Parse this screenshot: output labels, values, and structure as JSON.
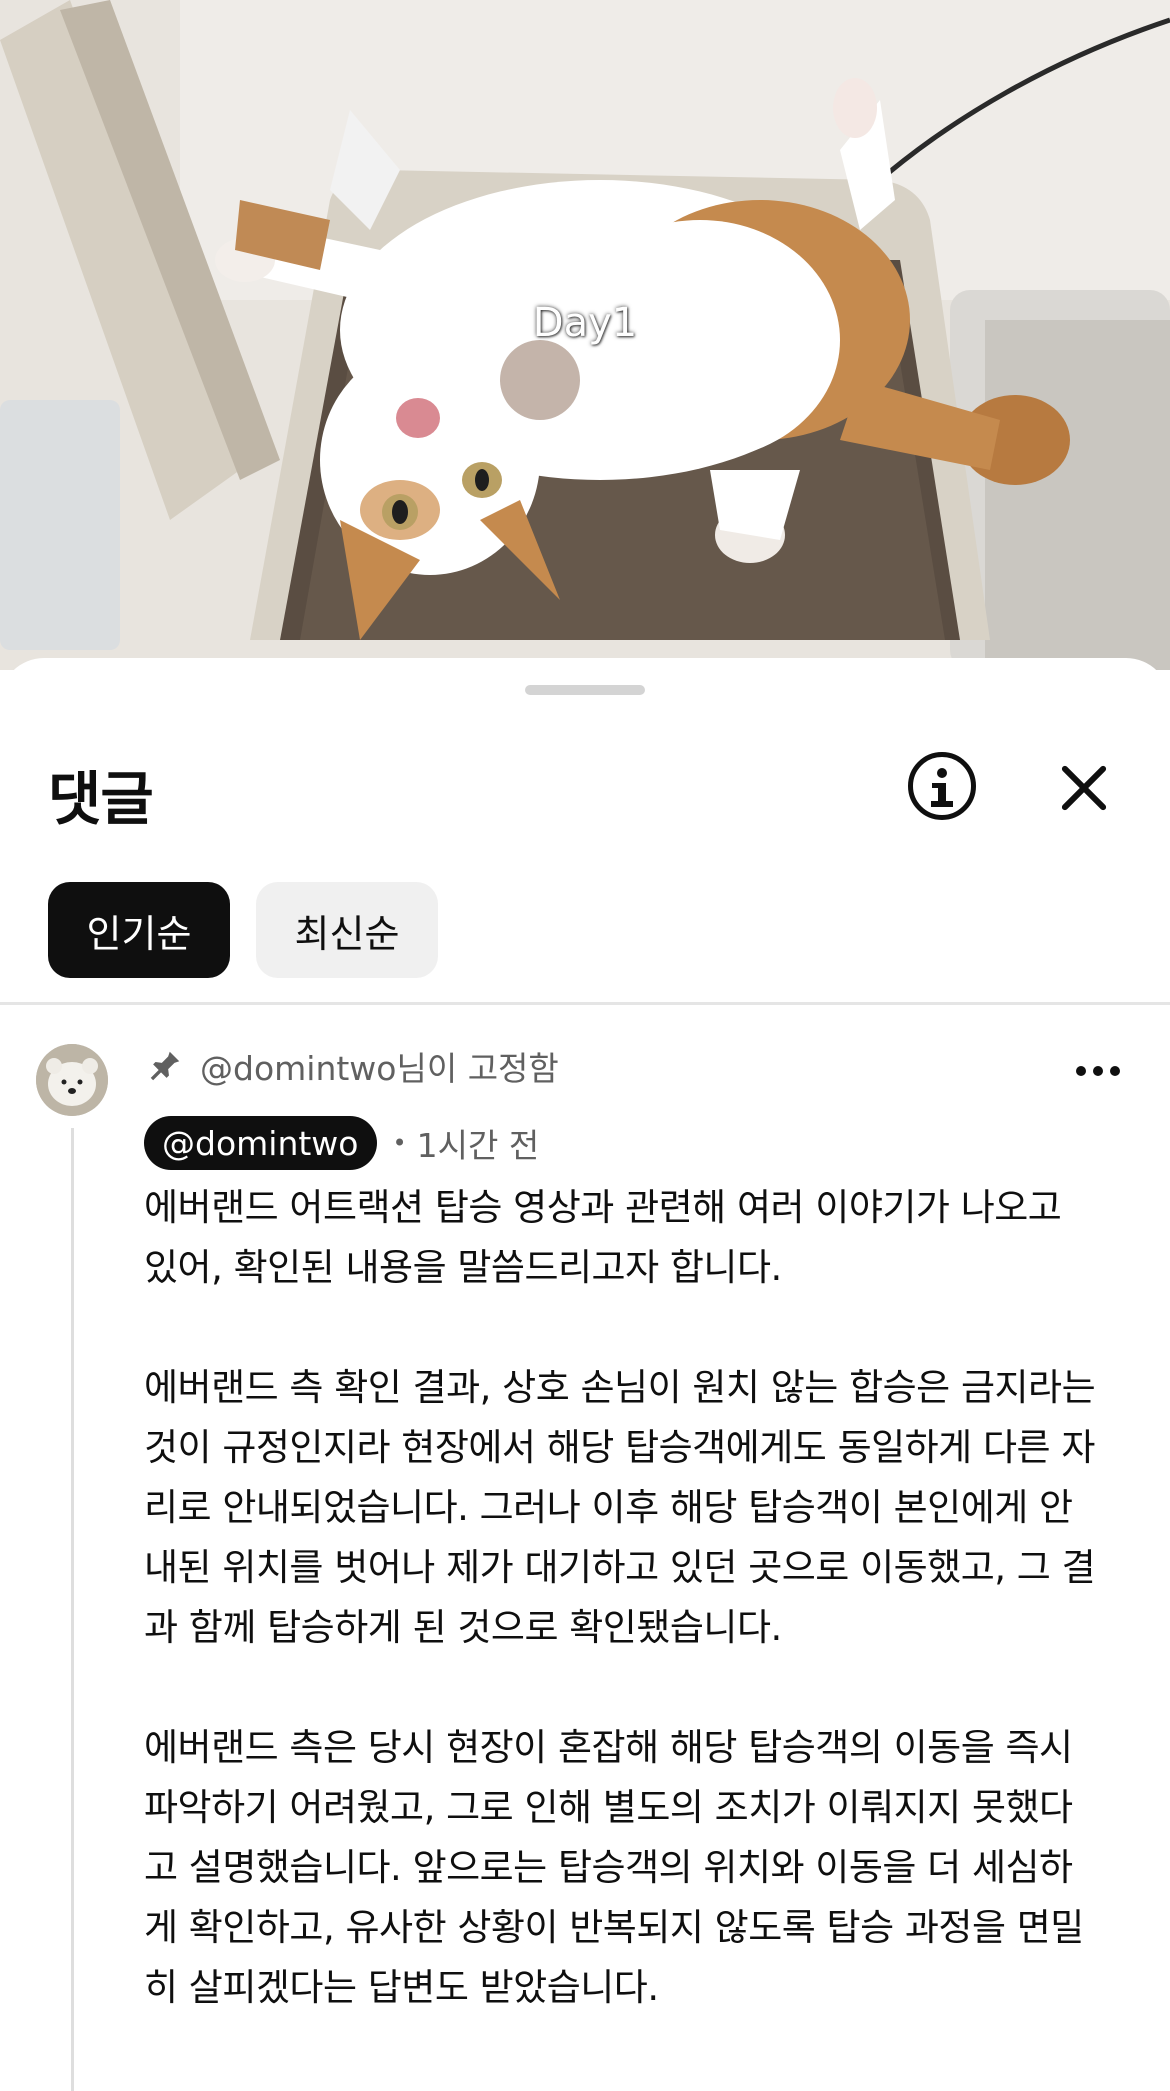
{
  "video": {
    "caption": "Day1"
  },
  "sheet": {
    "title": "댓글",
    "info_icon": "info-icon",
    "close_icon": "close-icon",
    "sort_tabs": [
      {
        "label": "인기순",
        "active": true
      },
      {
        "label": "최신순",
        "active": false
      }
    ]
  },
  "comment": {
    "pinned_text": "@domintwo님이 고정함",
    "pin_icon": "pin-icon",
    "author": "@domintwo",
    "separator": "•",
    "time": "1시간 전",
    "more_icon": "more-vertical-icon",
    "paragraphs": [
      "에버랜드 어트랙션 탑승 영상과 관련해 여러 이야기가 나오고 있어, 확인된 내용을 말씀드리고자 합니다.",
      "에버랜드 측 확인 결과, 상호 손님이 원치 않는 합승은 금지라는 것이 규정인지라 현장에서 해당 탑승객에게도 동일하게 다른 자리로 안내되었습니다. 그러나 이후 해당 탑승객이 본인에게 안내된 위치를 벗어나 제가 대기하고 있던 곳으로 이동했고, 그 결과 함께 탑승하게 된 것으로 확인됐습니다.",
      "에버랜드 측은 당시 현장이 혼잡해 해당 탑승객의 이동을 즉시 파악하기 어려웠고, 그로 인해 별도의 조치가 이뤄지지 못했다고 설명했습니다. 앞으로는 탑승객의 위치와 이동을 더 세심하게 확인하고, 유사한 상황이 반복되지 않도록 탑승 과정을 면밀히 살피겠다는 답변도 받았습니다."
    ]
  },
  "colors": {
    "text": "#0f0f0f",
    "muted": "#606060",
    "chip_idle": "#f0f0f0",
    "accent": "#0f0f0f"
  }
}
